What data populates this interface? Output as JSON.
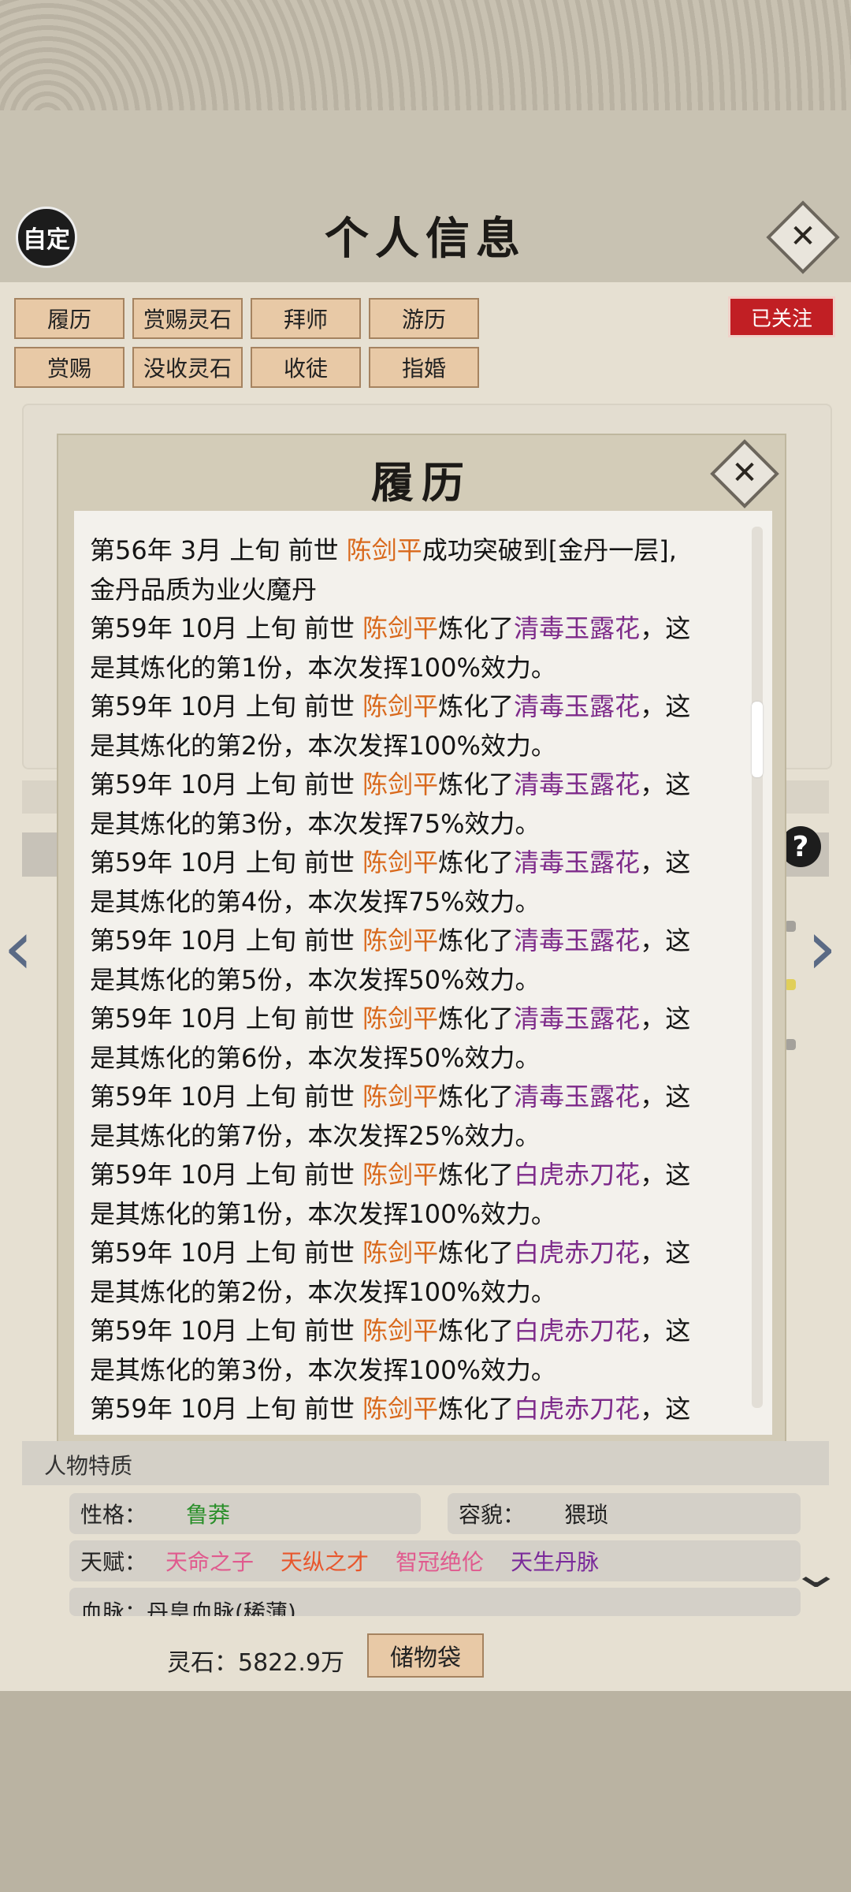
{
  "header": {
    "badge": "自定",
    "title": "个人信息"
  },
  "tabs": [
    [
      "履历",
      "赏赐灵石",
      "拜师",
      "游历"
    ],
    [
      "赏赐",
      "没收灵石",
      "收徒",
      "指婚"
    ]
  ],
  "follow_label": "已关注",
  "modal": {
    "title": "履历",
    "lines": [
      {
        "segments": [
          {
            "t": "第56年 3月 上旬  前世 ",
            "c": "n"
          },
          {
            "t": "陈剑平",
            "c": "o"
          },
          {
            "t": "成功突破到[金丹一层],",
            "c": "n"
          }
        ]
      },
      {
        "segments": [
          {
            "t": "金丹品质为业火魔丹",
            "c": "n"
          }
        ]
      },
      {
        "segments": [
          {
            "t": "第59年 10月 上旬  前世 ",
            "c": "n"
          },
          {
            "t": "陈剑平",
            "c": "o"
          },
          {
            "t": "炼化了",
            "c": "n"
          },
          {
            "t": "清毒玉露花",
            "c": "p"
          },
          {
            "t": "，这",
            "c": "n"
          }
        ]
      },
      {
        "segments": [
          {
            "t": "是其炼化的第1份，本次发挥100%效力。",
            "c": "n"
          }
        ]
      },
      {
        "segments": [
          {
            "t": "第59年 10月 上旬  前世 ",
            "c": "n"
          },
          {
            "t": "陈剑平",
            "c": "o"
          },
          {
            "t": "炼化了",
            "c": "n"
          },
          {
            "t": "清毒玉露花",
            "c": "p"
          },
          {
            "t": "，这",
            "c": "n"
          }
        ]
      },
      {
        "segments": [
          {
            "t": "是其炼化的第2份，本次发挥100%效力。",
            "c": "n"
          }
        ]
      },
      {
        "segments": [
          {
            "t": "第59年 10月 上旬  前世 ",
            "c": "n"
          },
          {
            "t": "陈剑平",
            "c": "o"
          },
          {
            "t": "炼化了",
            "c": "n"
          },
          {
            "t": "清毒玉露花",
            "c": "p"
          },
          {
            "t": "，这",
            "c": "n"
          }
        ]
      },
      {
        "segments": [
          {
            "t": "是其炼化的第3份，本次发挥75%效力。",
            "c": "n"
          }
        ]
      },
      {
        "segments": [
          {
            "t": "第59年 10月 上旬  前世 ",
            "c": "n"
          },
          {
            "t": "陈剑平",
            "c": "o"
          },
          {
            "t": "炼化了",
            "c": "n"
          },
          {
            "t": "清毒玉露花",
            "c": "p"
          },
          {
            "t": "，这",
            "c": "n"
          }
        ]
      },
      {
        "segments": [
          {
            "t": "是其炼化的第4份，本次发挥75%效力。",
            "c": "n"
          }
        ]
      },
      {
        "segments": [
          {
            "t": "第59年 10月 上旬  前世 ",
            "c": "n"
          },
          {
            "t": "陈剑平",
            "c": "o"
          },
          {
            "t": "炼化了",
            "c": "n"
          },
          {
            "t": "清毒玉露花",
            "c": "p"
          },
          {
            "t": "，这",
            "c": "n"
          }
        ]
      },
      {
        "segments": [
          {
            "t": "是其炼化的第5份，本次发挥50%效力。",
            "c": "n"
          }
        ]
      },
      {
        "segments": [
          {
            "t": "第59年 10月 上旬  前世 ",
            "c": "n"
          },
          {
            "t": "陈剑平",
            "c": "o"
          },
          {
            "t": "炼化了",
            "c": "n"
          },
          {
            "t": "清毒玉露花",
            "c": "p"
          },
          {
            "t": "，这",
            "c": "n"
          }
        ]
      },
      {
        "segments": [
          {
            "t": "是其炼化的第6份，本次发挥50%效力。",
            "c": "n"
          }
        ]
      },
      {
        "segments": [
          {
            "t": "第59年 10月 上旬  前世 ",
            "c": "n"
          },
          {
            "t": "陈剑平",
            "c": "o"
          },
          {
            "t": "炼化了",
            "c": "n"
          },
          {
            "t": "清毒玉露花",
            "c": "p"
          },
          {
            "t": "，这",
            "c": "n"
          }
        ]
      },
      {
        "segments": [
          {
            "t": "是其炼化的第7份，本次发挥25%效力。",
            "c": "n"
          }
        ]
      },
      {
        "segments": [
          {
            "t": "第59年 10月 上旬  前世 ",
            "c": "n"
          },
          {
            "t": "陈剑平",
            "c": "o"
          },
          {
            "t": "炼化了",
            "c": "n"
          },
          {
            "t": "白虎赤刀花",
            "c": "p"
          },
          {
            "t": "，这",
            "c": "n"
          }
        ]
      },
      {
        "segments": [
          {
            "t": "是其炼化的第1份，本次发挥100%效力。",
            "c": "n"
          }
        ]
      },
      {
        "segments": [
          {
            "t": "第59年 10月 上旬  前世 ",
            "c": "n"
          },
          {
            "t": "陈剑平",
            "c": "o"
          },
          {
            "t": "炼化了",
            "c": "n"
          },
          {
            "t": "白虎赤刀花",
            "c": "p"
          },
          {
            "t": "，这",
            "c": "n"
          }
        ]
      },
      {
        "segments": [
          {
            "t": "是其炼化的第2份，本次发挥100%效力。",
            "c": "n"
          }
        ]
      },
      {
        "segments": [
          {
            "t": "第59年 10月 上旬  前世 ",
            "c": "n"
          },
          {
            "t": "陈剑平",
            "c": "o"
          },
          {
            "t": "炼化了",
            "c": "n"
          },
          {
            "t": "白虎赤刀花",
            "c": "p"
          },
          {
            "t": "，这",
            "c": "n"
          }
        ]
      },
      {
        "segments": [
          {
            "t": "是其炼化的第3份，本次发挥100%效力。",
            "c": "n"
          }
        ]
      },
      {
        "segments": [
          {
            "t": "第59年 10月 上旬  前世 ",
            "c": "n"
          },
          {
            "t": "陈剑平",
            "c": "o"
          },
          {
            "t": "炼化了",
            "c": "n"
          },
          {
            "t": "白虎赤刀花",
            "c": "p"
          },
          {
            "t": "，这",
            "c": "n"
          }
        ]
      }
    ]
  },
  "traits": {
    "section_title": "人物特质",
    "personality_label": "性格：",
    "personality_value": "鲁莽",
    "appearance_label": "容貌：",
    "appearance_value": "猥琐",
    "talent_label": "天赋：",
    "talents": [
      {
        "text": "天命之子",
        "color": "#e05a8e"
      },
      {
        "text": "天纵之才",
        "color": "#e8562c"
      },
      {
        "text": "智冠绝伦",
        "color": "#e05a8e"
      },
      {
        "text": "天生丹脉",
        "color": "#7a2a9a"
      }
    ],
    "bloodline_text": "血脉：丹皇血脉(稀薄)"
  },
  "footer": {
    "spirit_stone": "灵石：5822.9万",
    "bag_label": "储物袋"
  },
  "colors": {
    "name_orange": "#d9691c",
    "item_purple": "#7d2a8a",
    "follow_red": "#c11f24",
    "tab_bg": "#e8c9a6"
  }
}
